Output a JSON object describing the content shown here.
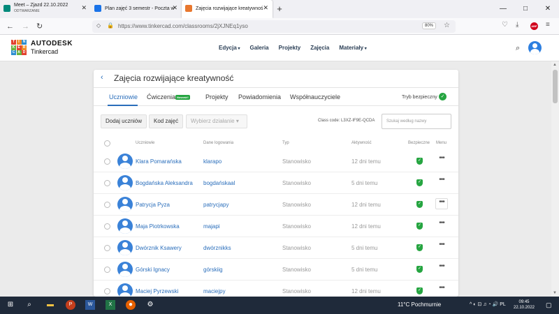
{
  "browser": {
    "tabs": [
      {
        "title": "Meet – Zjazd 22.10.2022",
        "subtitle": "ODTWARZANIE",
        "favicon_color": "#00897b"
      },
      {
        "title": "Plan zajęć 3 semestr - Poczta w",
        "subtitle": "",
        "favicon_color": "#1a73e8"
      },
      {
        "title": "Zajęcia rozwijające kreatywnoś",
        "subtitle": "",
        "favicon_color": "#e8772e"
      }
    ],
    "new_tab_label": "+",
    "window_controls": [
      "—",
      "□",
      "✕"
    ],
    "url": "https://www.tinkercad.com/classrooms/2jXJNEq1yso",
    "zoom": "80%",
    "adblock_label": "ABP"
  },
  "site": {
    "logo_letters": [
      "T",
      "I",
      "N",
      "K",
      "E",
      "R",
      "C",
      "A",
      "D"
    ],
    "logo_colors": [
      "#e2412e",
      "#f28b27",
      "#2c8ed0",
      "#6ab23e",
      "#e2412e",
      "#f28b27",
      "#2c8ed0",
      "#6ab23e",
      "#e2412e"
    ],
    "brand_top": "AUTODESK",
    "brand_bottom": "Tinkercad",
    "nav": [
      {
        "label": "Edycja",
        "dropdown": true
      },
      {
        "label": "Galeria",
        "dropdown": false
      },
      {
        "label": "Projekty",
        "dropdown": false
      },
      {
        "label": "Zajęcia",
        "dropdown": false
      },
      {
        "label": "Materiały",
        "dropdown": true
      }
    ]
  },
  "classroom": {
    "back_icon": "‹",
    "title": "Zajęcia rozwijające kreatywność",
    "tabs": [
      "Uczniowie",
      "Ćwiczenia",
      "Projekty",
      "Powiadomienia",
      "Współnauczyciele"
    ],
    "new_badge": "Nowość!",
    "safe_mode_label": "Tryb bezpieczny",
    "buttons": {
      "add_students": "Dodaj uczniów",
      "class_code": "Kod zajęć",
      "choose_action": "Wybierz działanie"
    },
    "class_code_text": "Class code: L3XZ-IF9E-QCDA",
    "search_placeholder": "Szukaj według nazwy",
    "columns": [
      "Uczniowie",
      "Dane logowania",
      "Typ",
      "Aktywność",
      "Bezpieczne",
      "Menu"
    ],
    "students": [
      {
        "name": "Klara Pomarańska",
        "login": "klarapo",
        "type": "Stanowisko",
        "activity": "12 dni temu"
      },
      {
        "name": "Bogdańska Aleksandra",
        "login": "bogdańskaal",
        "type": "Stanowisko",
        "activity": "5 dni temu"
      },
      {
        "name": "Patrycja Pyza",
        "login": "patrycjapy",
        "type": "Stanowisko",
        "activity": "12 dni temu"
      },
      {
        "name": "Maja Piotrkowska",
        "login": "majapi",
        "type": "Stanowisko",
        "activity": "12 dni temu"
      },
      {
        "name": "Dwórznik Ksawery",
        "login": "dwórznikks",
        "type": "Stanowisko",
        "activity": "5 dni temu"
      },
      {
        "name": "Górski Ignacy",
        "login": "górskiig",
        "type": "Stanowisko",
        "activity": "5 dni temu"
      },
      {
        "name": "Maciej Pyrzewski",
        "login": "maciejpy",
        "type": "Stanowisko",
        "activity": "12 dni temu"
      }
    ],
    "safe_color": "#26a541",
    "link_color": "#2a6ebb"
  },
  "taskbar": {
    "weather": "11°C  Pochmurnie",
    "time": "09:45",
    "date": "22.10.2022"
  }
}
